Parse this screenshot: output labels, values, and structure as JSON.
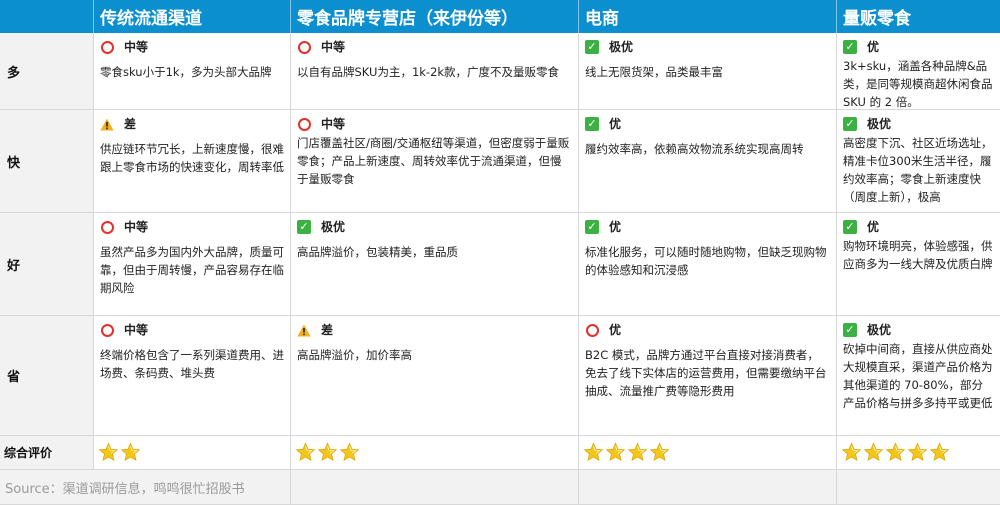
{
  "columns": [
    "",
    "传统流通渠道",
    "零食品牌专营店（来伊份等）",
    "电商",
    "量贩零食"
  ],
  "rows": [
    {
      "label": "多",
      "cells": [
        {
          "icon": "circle",
          "rating": "中等",
          "text": "零食sku小于1k，多为头部大品牌"
        },
        {
          "icon": "circle",
          "rating": "中等",
          "text": "以自有品牌SKU为主，1k-2k款，广度不及量贩零食"
        },
        {
          "icon": "check",
          "rating": "极优",
          "text": "线上无限货架，品类最丰富"
        },
        {
          "icon": "check",
          "rating": "优",
          "text": "3k+sku，涵盖各种品牌&品类，是同等规模商超休闲食品 SKU 的 2 倍。"
        }
      ]
    },
    {
      "label": "快",
      "cells": [
        {
          "icon": "warn",
          "rating": "差",
          "text": "供应链环节冗长，上新速度慢，很难跟上零食市场的快速变化，周转率低"
        },
        {
          "icon": "circle",
          "rating": "中等",
          "text": "门店覆盖社区/商圈/交通枢纽等渠道，但密度弱于量贩零食；产品上新速度、周转效率优于流通渠道，但慢于量贩零食"
        },
        {
          "icon": "check",
          "rating": "优",
          "text": "履约效率高，依赖高效物流系统实现高周转"
        },
        {
          "icon": "check",
          "rating": "极优",
          "text": "高密度下沉、社区近场选址，精准卡位300米生活半径，履约效率高；零食上新速度快（周度上新），极高"
        }
      ]
    },
    {
      "label": "好",
      "cells": [
        {
          "icon": "circle",
          "rating": "中等",
          "text": "虽然产品多为国内外大品牌，质量可靠，但由于周转慢，产品容易存在临期风险"
        },
        {
          "icon": "check",
          "rating": "极优",
          "text": "高品牌溢价，包装精美，重品质"
        },
        {
          "icon": "check",
          "rating": "优",
          "text": "标准化服务，可以随时随地购物，但缺乏现购物的体验感知和沉浸感"
        },
        {
          "icon": "check",
          "rating": "优",
          "text": "购物环境明亮，体验感强，供应商多为一线大牌及优质白牌"
        }
      ]
    },
    {
      "label": "省",
      "cells": [
        {
          "icon": "circle",
          "rating": "中等",
          "text": "终端价格包含了一系列渠道费用、进场费、条码费、堆头费"
        },
        {
          "icon": "warn",
          "rating": "差",
          "text": "高品牌溢价，加价率高"
        },
        {
          "icon": "circle",
          "rating": "优",
          "text": "B2C 模式，品牌方通过平台直接对接消费者，免去了线下实体店的运营费用，但需要缴纳平台抽成、流量推广费等隐形费用"
        },
        {
          "icon": "check",
          "rating": "极优",
          "text": "砍掉中间商，直接从供应商处大规模直采，渠道产品价格为其他渠道的 70-80%，部分产品价格与拼多多持平或更低"
        }
      ]
    }
  ],
  "summary": {
    "label": "综合评价",
    "stars": [
      2,
      3,
      4,
      5
    ]
  },
  "source": "Source：渠道调研信息，鸣鸣很忙招股书",
  "colors": {
    "header_bg": "#0c8fcf",
    "circle": "#e5302a",
    "check": "#3cb043",
    "warn": "#f2b01e",
    "star": "#f5c518"
  }
}
